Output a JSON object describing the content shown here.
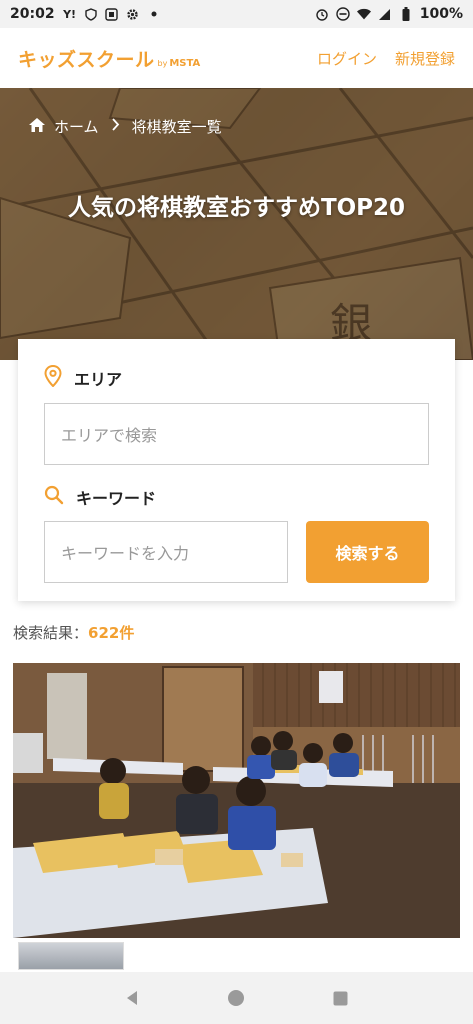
{
  "status": {
    "time": "20:02",
    "battery": "100%"
  },
  "header": {
    "logo_main": "キッズスクール",
    "logo_by": "by",
    "logo_brand": "MSTA",
    "login": "ログイン",
    "signup": "新規登録"
  },
  "hero": {
    "breadcrumb_home": "ホーム",
    "breadcrumb_current": "将棋教室一覧",
    "title": "人気の将棋教室おすすめTOP20"
  },
  "search": {
    "area_label": "エリア",
    "area_placeholder": "エリアで検索",
    "keyword_label": "キーワード",
    "keyword_placeholder": "キーワードを入力",
    "button": "検索する"
  },
  "results": {
    "label": "検索結果：",
    "count": "622件"
  },
  "colors": {
    "accent": "#f2a032"
  }
}
